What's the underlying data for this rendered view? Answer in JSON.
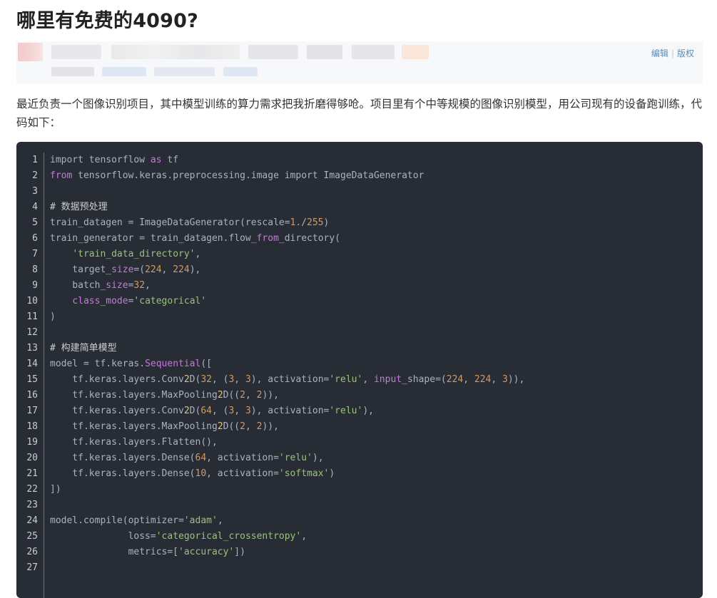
{
  "title": "哪里有免费的4090?",
  "meta": {
    "edit_label": "编辑",
    "separator": "|",
    "copyright_label": "版权"
  },
  "intro": "最近负责一个图像识别项目，其中模型训练的算力需求把我折磨得够呛。项目里有个中等规模的图像识别模型，用公司现有的设备跑训练，代码如下：",
  "code": {
    "language": "python",
    "lines": [
      [
        [
          "c-pl",
          "import tensorflow "
        ],
        [
          "c-kw",
          "as"
        ],
        [
          "c-pl",
          " tf"
        ]
      ],
      [
        [
          "c-kw",
          "from"
        ],
        [
          "c-pl",
          " tensorflow.keras.preprocessing.image import ImageDataGenerator"
        ]
      ],
      [],
      [
        [
          "c-com",
          "# 数据预处理"
        ]
      ],
      [
        [
          "c-pl",
          "train_datagen = ImageDataGenerator(rescale="
        ],
        [
          "c-num",
          "1."
        ],
        [
          "c-pl",
          "/"
        ],
        [
          "c-num",
          "255"
        ],
        [
          "c-pl",
          ")"
        ]
      ],
      [
        [
          "c-pl",
          "train_generator = train_datagen.flow_"
        ],
        [
          "c-mg",
          "from"
        ],
        [
          "c-pl",
          "_directory("
        ]
      ],
      [
        [
          "c-pl",
          "    "
        ],
        [
          "c-str",
          "'train_data_directory'"
        ],
        [
          "c-pl",
          ","
        ]
      ],
      [
        [
          "c-pl",
          "    target_"
        ],
        [
          "c-mg",
          "size"
        ],
        [
          "c-pl",
          "=("
        ],
        [
          "c-num",
          "224"
        ],
        [
          "c-pl",
          ", "
        ],
        [
          "c-num",
          "224"
        ],
        [
          "c-pl",
          "),"
        ]
      ],
      [
        [
          "c-pl",
          "    batch_"
        ],
        [
          "c-mg",
          "size"
        ],
        [
          "c-pl",
          "="
        ],
        [
          "c-num",
          "32"
        ],
        [
          "c-pl",
          ","
        ]
      ],
      [
        [
          "c-pl",
          "    "
        ],
        [
          "c-mg",
          "class"
        ],
        [
          "c-pl",
          "_"
        ],
        [
          "c-mg",
          "mode"
        ],
        [
          "c-pl",
          "="
        ],
        [
          "c-str",
          "'categorical'"
        ]
      ],
      [
        [
          "c-pl",
          ")"
        ]
      ],
      [],
      [
        [
          "c-com",
          "# 构建简单模型"
        ]
      ],
      [
        [
          "c-pl",
          "model = tf.keras."
        ],
        [
          "c-mg",
          "Sequential"
        ],
        [
          "c-pl",
          "(["
        ]
      ],
      [
        [
          "c-pl",
          "    tf.keras.layers.Conv"
        ],
        [
          "c-yl",
          "2"
        ],
        [
          "c-pl",
          "D("
        ],
        [
          "c-num",
          "32"
        ],
        [
          "c-pl",
          ", ("
        ],
        [
          "c-num",
          "3"
        ],
        [
          "c-pl",
          ", "
        ],
        [
          "c-num",
          "3"
        ],
        [
          "c-pl",
          "), activation="
        ],
        [
          "c-str",
          "'relu'"
        ],
        [
          "c-pl",
          ", "
        ],
        [
          "c-mg",
          "input"
        ],
        [
          "c-pl",
          "_shape=("
        ],
        [
          "c-num",
          "224"
        ],
        [
          "c-pl",
          ", "
        ],
        [
          "c-num",
          "224"
        ],
        [
          "c-pl",
          ", "
        ],
        [
          "c-num",
          "3"
        ],
        [
          "c-pl",
          ")),"
        ]
      ],
      [
        [
          "c-pl",
          "    tf.keras.layers.MaxPooling"
        ],
        [
          "c-yl",
          "2"
        ],
        [
          "c-pl",
          "D(("
        ],
        [
          "c-num",
          "2"
        ],
        [
          "c-pl",
          ", "
        ],
        [
          "c-num",
          "2"
        ],
        [
          "c-pl",
          ")),"
        ]
      ],
      [
        [
          "c-pl",
          "    tf.keras.layers.Conv"
        ],
        [
          "c-yl",
          "2"
        ],
        [
          "c-pl",
          "D("
        ],
        [
          "c-num",
          "64"
        ],
        [
          "c-pl",
          ", ("
        ],
        [
          "c-num",
          "3"
        ],
        [
          "c-pl",
          ", "
        ],
        [
          "c-num",
          "3"
        ],
        [
          "c-pl",
          "), activation="
        ],
        [
          "c-str",
          "'relu'"
        ],
        [
          "c-pl",
          "),"
        ]
      ],
      [
        [
          "c-pl",
          "    tf.keras.layers.MaxPooling"
        ],
        [
          "c-yl",
          "2"
        ],
        [
          "c-pl",
          "D(("
        ],
        [
          "c-num",
          "2"
        ],
        [
          "c-pl",
          ", "
        ],
        [
          "c-num",
          "2"
        ],
        [
          "c-pl",
          ")),"
        ]
      ],
      [
        [
          "c-pl",
          "    tf.keras.layers.Flatten(),"
        ]
      ],
      [
        [
          "c-pl",
          "    tf.keras.layers.Dense("
        ],
        [
          "c-num",
          "64"
        ],
        [
          "c-pl",
          ", activation="
        ],
        [
          "c-str",
          "'relu'"
        ],
        [
          "c-pl",
          "),"
        ]
      ],
      [
        [
          "c-pl",
          "    tf.keras.layers.Dense("
        ],
        [
          "c-num",
          "10"
        ],
        [
          "c-pl",
          ", activation="
        ],
        [
          "c-str",
          "'softmax'"
        ],
        [
          "c-pl",
          ")"
        ]
      ],
      [
        [
          "c-pl",
          "])"
        ]
      ],
      [],
      [
        [
          "c-pl",
          "model.compile(optimizer="
        ],
        [
          "c-str",
          "'adam'"
        ],
        [
          "c-pl",
          ","
        ]
      ],
      [
        [
          "c-pl",
          "              loss="
        ],
        [
          "c-str",
          "'categorical_crossentropy'"
        ],
        [
          "c-pl",
          ","
        ]
      ],
      [
        [
          "c-pl",
          "              metrics=["
        ],
        [
          "c-str",
          "'accuracy'"
        ],
        [
          "c-pl",
          "])"
        ]
      ],
      []
    ]
  }
}
